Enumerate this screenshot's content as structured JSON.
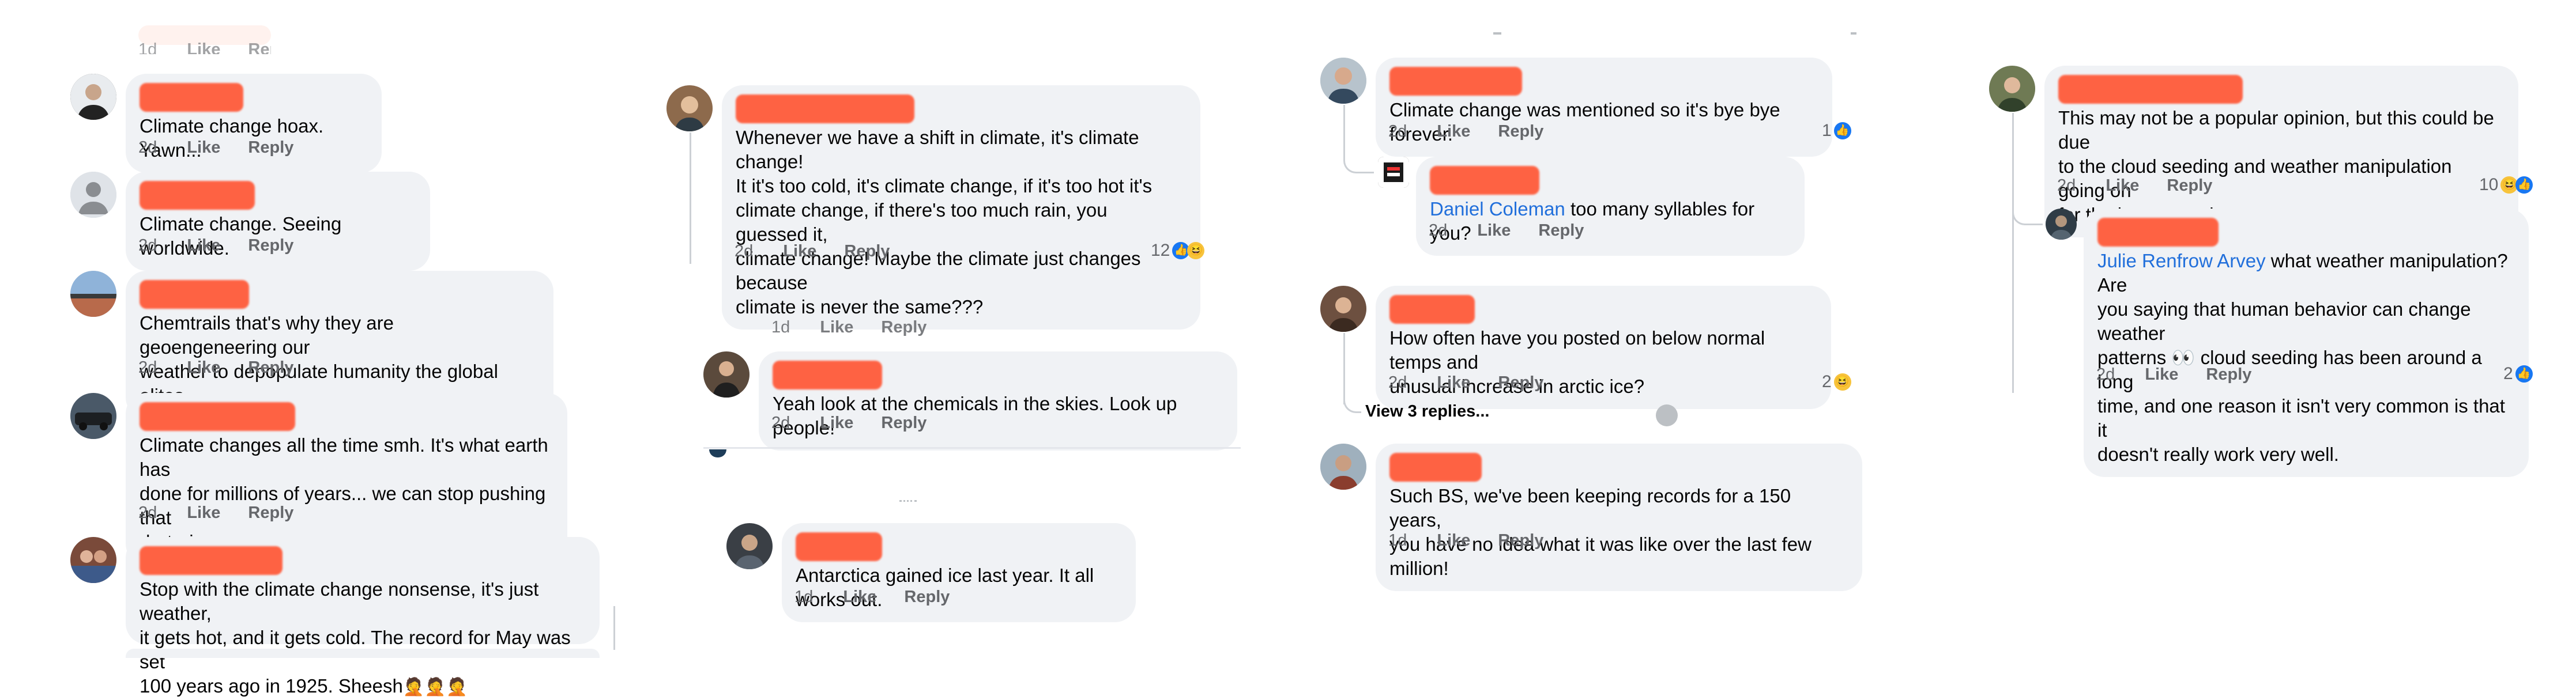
{
  "actions": {
    "like": "Like",
    "reply": "Reply"
  },
  "columns": [
    {
      "top_partial": {
        "time": "1d",
        "like": "Like",
        "reply": "Reply"
      },
      "comments": [
        {
          "text": "Climate change hoax. Yawn...",
          "time": "2d"
        },
        {
          "text": "Climate change. Seeing worldwide.",
          "time": "2d"
        },
        {
          "text": "Chemtrails that's why they are geoengeneering our\nweather to depopulate humanity the global elites.",
          "time": "2d"
        },
        {
          "text": "Climate changes all the time smh. It's what earth has\ndone for millions of years... we can stop pushing that\nrhetoric now.",
          "time": "2d"
        },
        {
          "text": "Stop with the climate change nonsense, it's just weather,\nit gets hot, and it gets cold. The record for May was set\n100 years ago in 1925. Sheesh",
          "emoji": "🤦🤦🤦"
        }
      ]
    },
    {
      "comments": [
        {
          "text": "Whenever we have a shift in climate, it's climate change!\nIt it's too cold, it's climate change, if it's too hot it's\nclimate change, if there's too much rain, you guessed it,\nclimate change! Maybe the climate just changes because\nclimate is never the same???",
          "time": "2d",
          "reactions": "12"
        },
        {
          "partial": {
            "time": "1d",
            "like": "Like",
            "reply": "Reply"
          }
        },
        {
          "text": "Yeah look at the chemicals in the skies. Look up people!",
          "time": "2d"
        },
        {
          "text": "Antarctica gained ice last year. It all works out.",
          "time": "1d"
        }
      ]
    },
    {
      "comments": [
        {
          "text": "Climate change was mentioned so it's bye bye forever.",
          "time": "2d",
          "reactions": "1"
        },
        {
          "mention": "Daniel Coleman",
          "text": " too many syllables for you?",
          "time": "2d"
        },
        {
          "text": "How often have you posted on below normal temps and\nunusual increase in arctic ice?",
          "time": "2d",
          "reactions": "2"
        },
        {
          "view_replies": "View 3 replies..."
        },
        {
          "text": "Such BS, we've been keeping records for a 150 years,\nyou have no idea what it was like over the last few million!",
          "time": "1d"
        }
      ]
    },
    {
      "comments": [
        {
          "text": "This may not be a popular opinion, but this could be due\nto the cloud seeding and weather manipulation going on\nfor the last several years.",
          "time": "2d",
          "reactions": "10"
        },
        {
          "mention": "Julie Renfrow Arvey",
          "text": " what weather manipulation? Are\nyou saying that human behavior can change weather\npatterns 👀 cloud seeding has been around a long\ntime, and one reason it isn't very common is that it\ndoesn't really work very well.",
          "time": "2d",
          "reactions": "2"
        }
      ]
    }
  ],
  "icons": {
    "like": "like-reaction-icon",
    "haha": "haha-reaction-icon",
    "avatar": "profile-avatar"
  },
  "colors": {
    "bubble": "#f0f2f5",
    "redaction": "#ff5b3a",
    "mention": "#216fdb",
    "like_blue": "#1877f2",
    "meta_gray": "#65676b"
  }
}
